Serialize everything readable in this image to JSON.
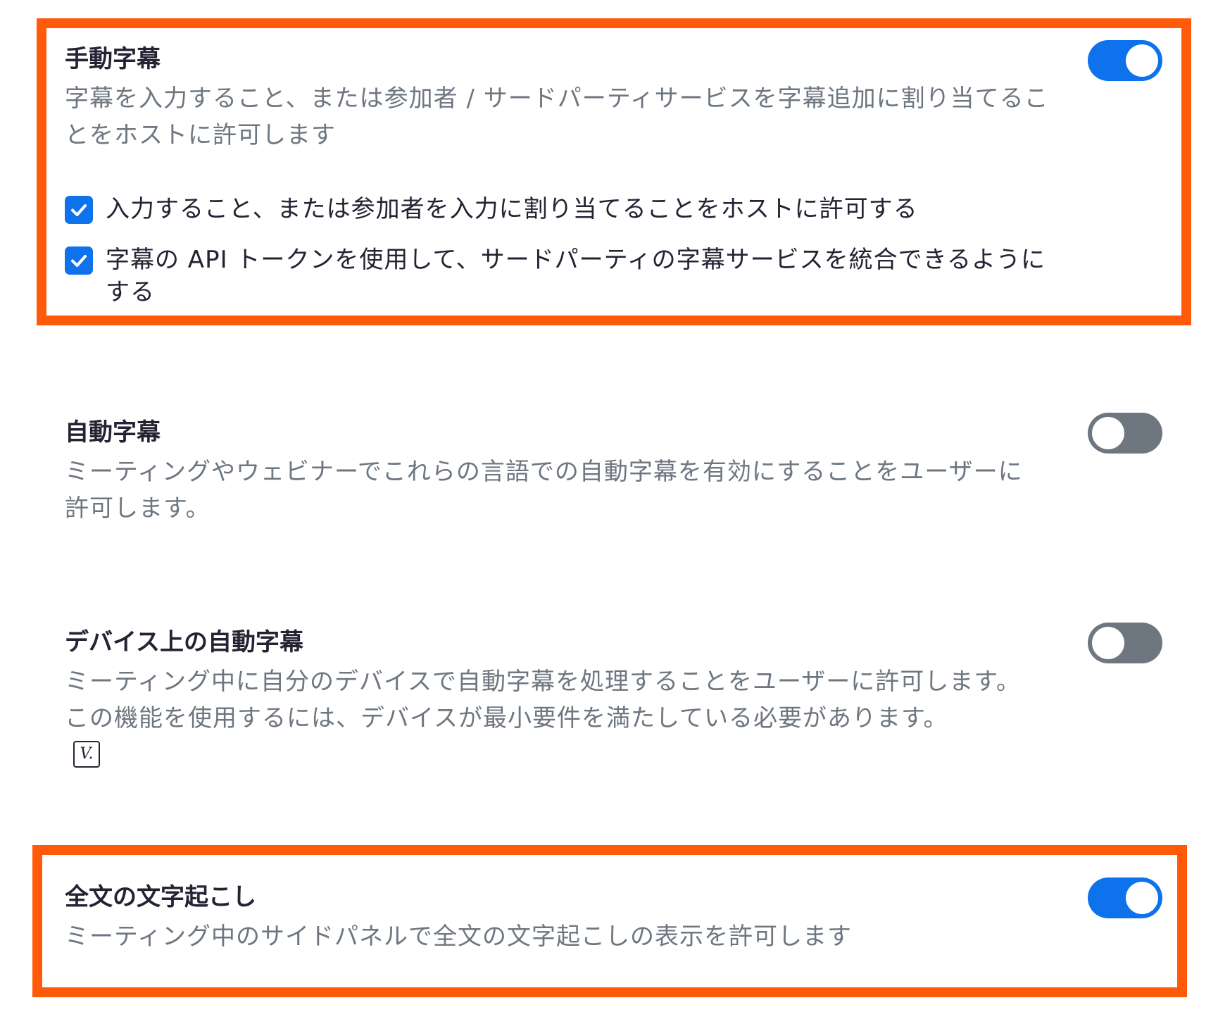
{
  "colors": {
    "highlight": "#ff5a0a",
    "toggle_on": "#0e72ed",
    "toggle_off": "#6e7680",
    "title_text": "#232333",
    "description_text": "#6e7680"
  },
  "settings": [
    {
      "title": "手動字幕",
      "description": "字幕を入力すること、または参加者 / サードパーティサービスを字幕追加に割り当てることをホストに許可します",
      "enabled": true,
      "options": [
        {
          "label": "入力すること、または参加者を入力に割り当てることをホストに許可する",
          "checked": true
        },
        {
          "label": "字幕の API トークンを使用して、サードパーティの字幕サービスを統合できるようにする",
          "checked": true
        }
      ]
    },
    {
      "title": "自動字幕",
      "description": "ミーティングやウェビナーでこれらの言語での自動字幕を有効にすることをユーザーに許可します。",
      "enabled": false
    },
    {
      "title": "デバイス上の自動字幕",
      "description": "ミーティング中に自分のデバイスで自動字幕を処理することをユーザーに許可します。この機能を使用するには、デバイスが最小要件を満たしている必要があります。",
      "enabled": false,
      "icon": "version-info-icon",
      "icon_glyph": "V."
    },
    {
      "title": "全文の文字起こし",
      "description": "ミーティング中のサイドパネルで全文の文字起こしの表示を許可します",
      "enabled": true
    }
  ]
}
